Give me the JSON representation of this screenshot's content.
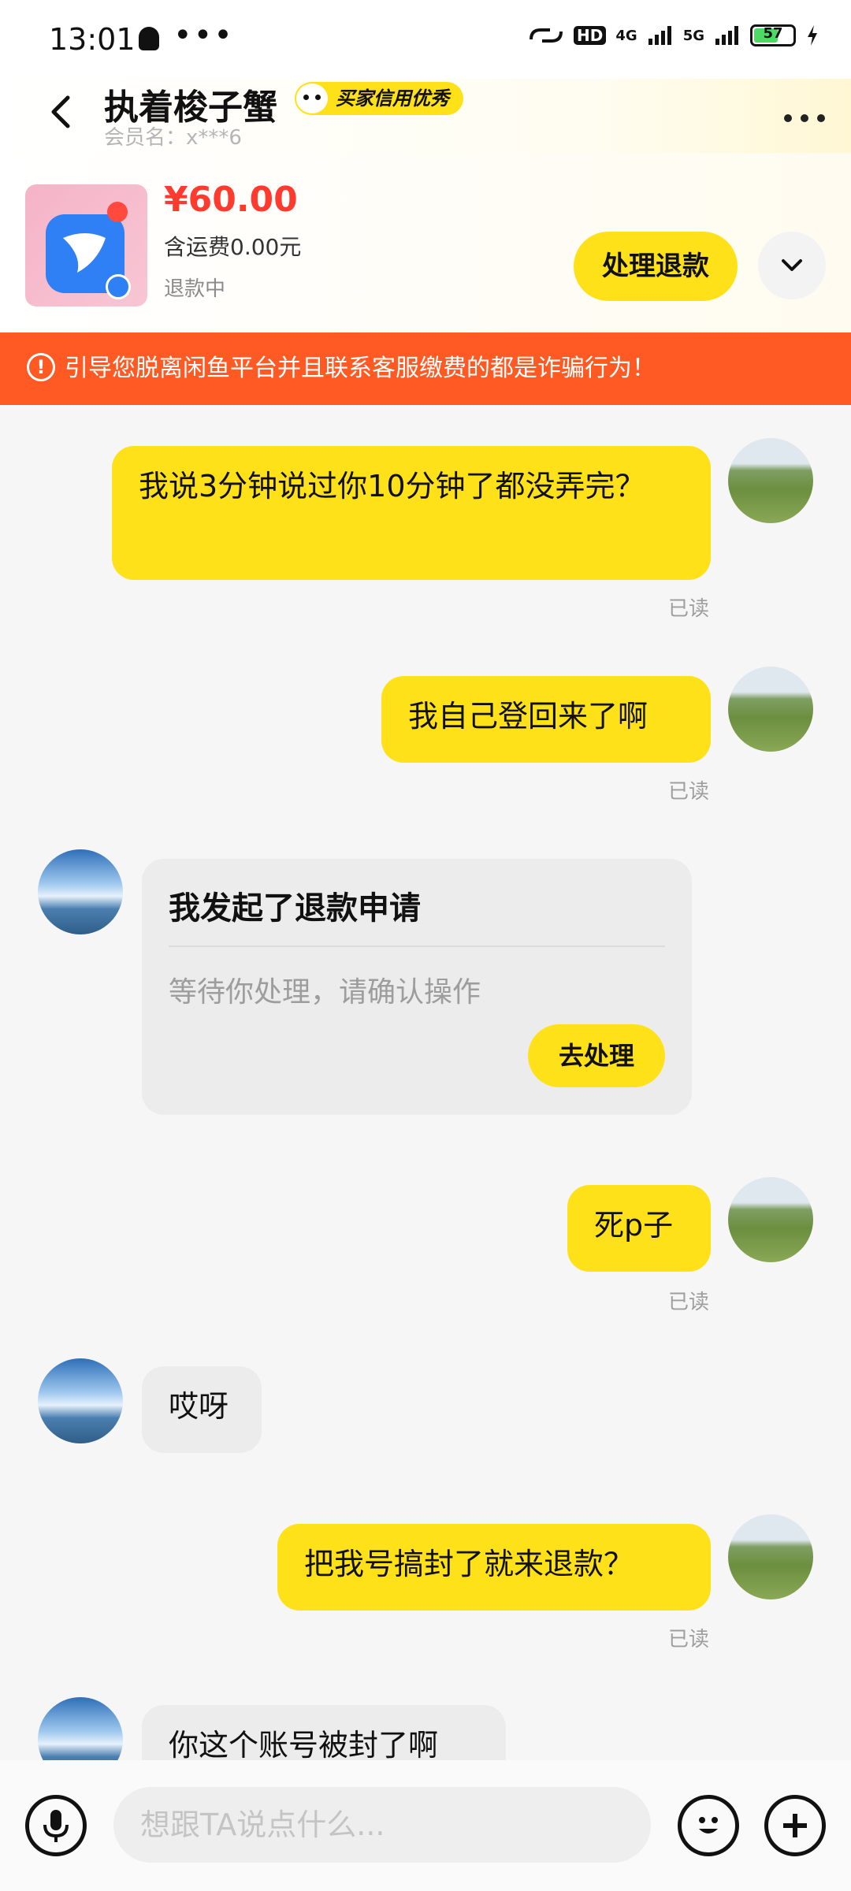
{
  "status_bar": {
    "time": "13:01",
    "more": "•••",
    "network": "4G",
    "network2": "5G",
    "hd": "HD",
    "battery": "57"
  },
  "header": {
    "back_icon": "chevron-left-icon",
    "title": "执着梭子蟹",
    "badge": "买家信用优秀",
    "member": "会员名：x***6",
    "more_icon": "more-horizontal-icon"
  },
  "item": {
    "price": "¥60.00",
    "shipping": "含运费0.00元",
    "status": "退款中",
    "refund_button": "处理退款"
  },
  "warning": {
    "text": "引导您脱离闲鱼平台并且联系客服缴费的都是诈骗行为！"
  },
  "messages": [
    {
      "side": "mine",
      "text": "我说3分钟说过你10分钟了都没弄完？",
      "read": "已读"
    },
    {
      "side": "mine",
      "text": "我自己登回来了啊",
      "read": "已读"
    },
    {
      "side": "theirs",
      "card_title": "我发起了退款申请",
      "card_sub": "等待你处理，请确认操作",
      "card_button": "去处理"
    },
    {
      "side": "mine",
      "text": "死p子",
      "read": "已读"
    },
    {
      "side": "theirs",
      "text": "哎呀"
    },
    {
      "side": "mine",
      "text": "把我号搞封了就来退款？",
      "read": "已读"
    },
    {
      "side": "theirs",
      "text": "你这个账号被封了啊"
    }
  ],
  "bottom_bar": {
    "voice_icon": "microphone-icon",
    "placeholder": "想跟TA说点什么...",
    "emoji_icon": "emoji-icon",
    "add_icon": "plus-icon"
  },
  "colors": {
    "accent": "#ffe11a",
    "warning": "#ff5a23",
    "price": "#ff3b2f"
  }
}
